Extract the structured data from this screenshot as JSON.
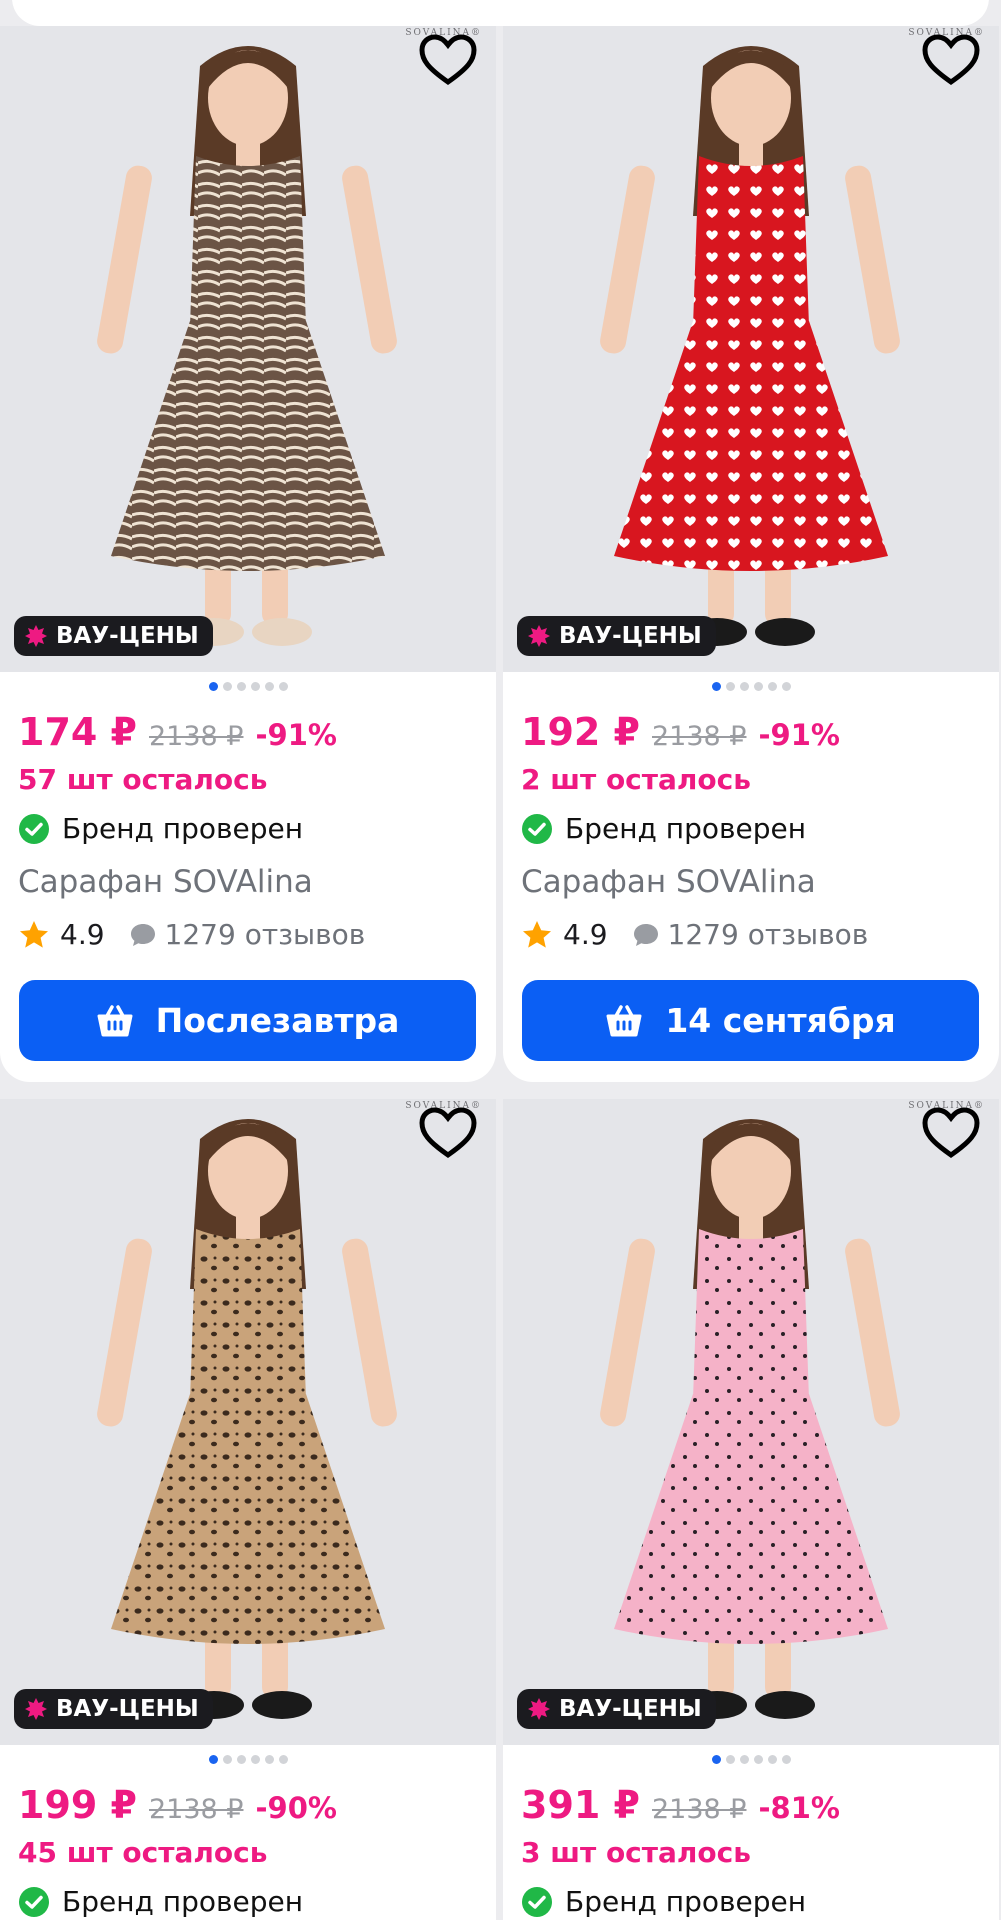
{
  "colors": {
    "accent_pink": "#ee1a82",
    "button_blue": "#0b5ff4",
    "verified_green": "#20b847",
    "star_orange": "#ffa200",
    "badge_dark": "#1b1b1f"
  },
  "products": [
    {
      "dress_color": "#6b5445",
      "pattern": "zebra",
      "badge": "ВАУ-ЦЕНЫ",
      "price": "174 ₽",
      "old_price": "2138 ₽",
      "discount": "-91%",
      "stock": "57 шт осталось",
      "verified": "Бренд проверен",
      "title": "Сарафан SOVAlina",
      "rating": "4.9",
      "reviews": "1279 отзывов",
      "button_label": "Послезавтра"
    },
    {
      "dress_color": "#d8161f",
      "pattern": "hearts",
      "badge": "ВАУ-ЦЕНЫ",
      "price": "192 ₽",
      "old_price": "2138 ₽",
      "discount": "-91%",
      "stock": "2 шт осталось",
      "verified": "Бренд проверен",
      "title": "Сарафан SOVAlina",
      "rating": "4.9",
      "reviews": "1279 отзывов",
      "button_label": "14 сентября"
    },
    {
      "dress_color": "#c9a37a",
      "pattern": "leopard",
      "badge": "ВАУ-ЦЕНЫ",
      "price": "199 ₽",
      "old_price": "2138 ₽",
      "discount": "-90%",
      "stock": "45 шт осталось",
      "verified": "Бренд проверен",
      "title": "",
      "rating": "",
      "reviews": "",
      "button_label": ""
    },
    {
      "dress_color": "#f5b2c8",
      "pattern": "dots",
      "badge": "ВАУ-ЦЕНЫ",
      "price": "391 ₽",
      "old_price": "2138 ₽",
      "discount": "-81%",
      "stock": "3 шт осталось",
      "verified": "Бренд проверен",
      "title": "",
      "rating": "",
      "reviews": "",
      "button_label": ""
    }
  ],
  "brand_mark": "SOVALINA®"
}
